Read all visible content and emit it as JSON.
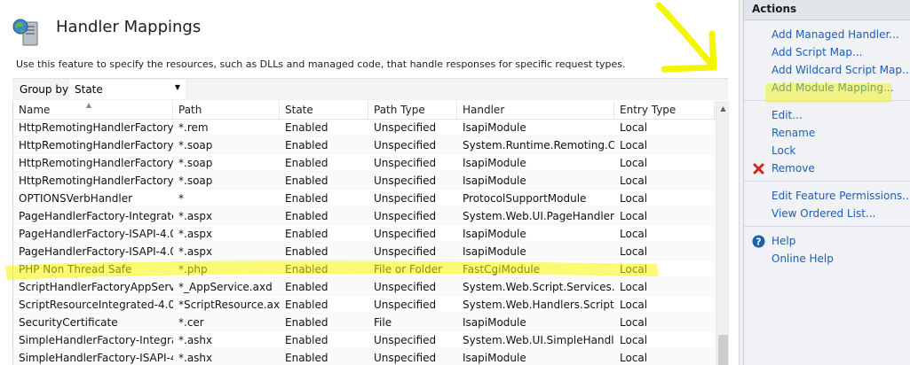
{
  "page": {
    "title": "Handler Mappings",
    "description": "Use this feature to specify the resources, such as DLLs and managed code, that handle responses for specific request types."
  },
  "toolbar": {
    "group_by_label": "Group by:",
    "group_by_value": "State"
  },
  "grid": {
    "columns": [
      "Name",
      "Path",
      "State",
      "Path Type",
      "Handler",
      "Entry Type"
    ],
    "rows": [
      [
        "HttpRemotingHandlerFactory...",
        "*.rem",
        "Enabled",
        "Unspecified",
        "IsapiModule",
        "Local"
      ],
      [
        "HttpRemotingHandlerFactory...",
        "*.soap",
        "Enabled",
        "Unspecified",
        "System.Runtime.Remoting.C...",
        "Local"
      ],
      [
        "HttpRemotingHandlerFactory...",
        "*.soap",
        "Enabled",
        "Unspecified",
        "IsapiModule",
        "Local"
      ],
      [
        "HttpRemotingHandlerFactory...",
        "*.soap",
        "Enabled",
        "Unspecified",
        "IsapiModule",
        "Local"
      ],
      [
        "OPTIONSVerbHandler",
        "*",
        "Enabled",
        "Unspecified",
        "ProtocolSupportModule",
        "Local"
      ],
      [
        "PageHandlerFactory-Integrate...",
        "*.aspx",
        "Enabled",
        "Unspecified",
        "System.Web.UI.PageHandlerF...",
        "Local"
      ],
      [
        "PageHandlerFactory-ISAPI-4.0...",
        "*.aspx",
        "Enabled",
        "Unspecified",
        "IsapiModule",
        "Local"
      ],
      [
        "PageHandlerFactory-ISAPI-4.0...",
        "*.aspx",
        "Enabled",
        "Unspecified",
        "IsapiModule",
        "Local"
      ],
      [
        "PHP Non Thread Safe",
        "*.php",
        "Enabled",
        "File or Folder",
        "FastCgiModule",
        "Local"
      ],
      [
        "ScriptHandlerFactoryAppServi...",
        "*_AppService.axd",
        "Enabled",
        "Unspecified",
        "System.Web.Script.Services.S...",
        "Local"
      ],
      [
        "ScriptResourceIntegrated-4.0",
        "*ScriptResource.axd",
        "Enabled",
        "Unspecified",
        "System.Web.Handlers.ScriptR...",
        "Local"
      ],
      [
        "SecurityCertificate",
        "*.cer",
        "Enabled",
        "File",
        "IsapiModule",
        "Local"
      ],
      [
        "SimpleHandlerFactory-Integra...",
        "*.ashx",
        "Enabled",
        "Unspecified",
        "System.Web.UI.SimpleHandle...",
        "Local"
      ],
      [
        "SimpleHandlerFactory-ISAPI-4...",
        "*.ashx",
        "Enabled",
        "Unspecified",
        "IsapiModule",
        "Local"
      ]
    ]
  },
  "actions": {
    "title": "Actions",
    "groups": [
      [
        {
          "label": "Add Managed Handler...",
          "icon": ""
        },
        {
          "label": "Add Script Map...",
          "icon": ""
        },
        {
          "label": "Add Wildcard Script Map...",
          "icon": ""
        },
        {
          "label": "Add Module Mapping...",
          "icon": ""
        }
      ],
      [
        {
          "label": "Edit...",
          "icon": ""
        },
        {
          "label": "Rename",
          "icon": ""
        },
        {
          "label": "Lock",
          "icon": ""
        },
        {
          "label": "Remove",
          "icon": "remove-icon"
        }
      ],
      [
        {
          "label": "Edit Feature Permissions...",
          "icon": ""
        },
        {
          "label": "View Ordered List...",
          "icon": ""
        }
      ],
      [
        {
          "label": "Help",
          "icon": "help-icon"
        },
        {
          "label": "Online Help",
          "icon": ""
        }
      ]
    ]
  },
  "colors": {
    "highlighter": "#f5f500",
    "link": "#1b5fb4",
    "remove": "#d0281e",
    "help": "#1f5faa"
  }
}
